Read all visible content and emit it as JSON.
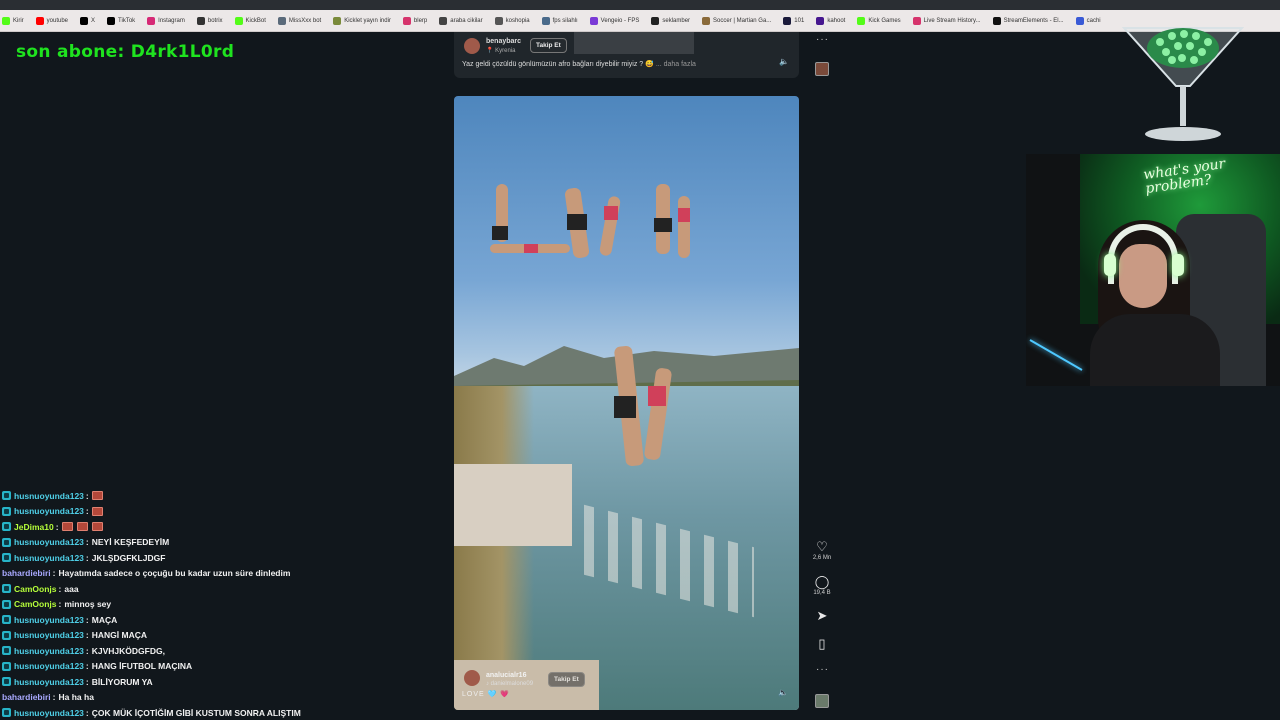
{
  "bookmarks": [
    {
      "label": "Kirir",
      "icon": "kick-icon",
      "color": "#53fc18"
    },
    {
      "label": "youtube",
      "icon": "youtube-icon",
      "color": "#ff0000"
    },
    {
      "label": "X",
      "icon": "x-icon",
      "color": "#000000"
    },
    {
      "label": "TikTok",
      "icon": "tiktok-icon",
      "color": "#000000"
    },
    {
      "label": "Instagram",
      "icon": "instagram-icon",
      "color": "#d62976"
    },
    {
      "label": "botrix",
      "icon": "botrix-icon",
      "color": "#333333"
    },
    {
      "label": "KickBot",
      "icon": "kickbot-icon",
      "color": "#53fc18"
    },
    {
      "label": "MissXxx bot",
      "icon": "bot-icon",
      "color": "#5a6a7a"
    },
    {
      "label": "Kicklet yayın indir",
      "icon": "kicklet-icon",
      "color": "#7a8a3a"
    },
    {
      "label": "blerp",
      "icon": "blerp-icon",
      "color": "#d6336c"
    },
    {
      "label": "araba cikilar",
      "icon": "car-icon",
      "color": "#444444"
    },
    {
      "label": "koshopia",
      "icon": "koshopia-icon",
      "color": "#555555"
    },
    {
      "label": "fps silahlı",
      "icon": "fps-icon",
      "color": "#4a6a8a"
    },
    {
      "label": "Vengeio - FPS",
      "icon": "vengeio-icon",
      "color": "#7a3ad6"
    },
    {
      "label": "seklamber",
      "icon": "seklamber-icon",
      "color": "#222222"
    },
    {
      "label": "Soccer | Martian Ga...",
      "icon": "soccer-icon",
      "color": "#8a6a3a"
    },
    {
      "label": "101",
      "icon": "101-icon",
      "color": "#1a1a3a"
    },
    {
      "label": "kahoot",
      "icon": "kahoot-icon",
      "color": "#46178f"
    },
    {
      "label": "Kick Games",
      "icon": "kick-games-icon",
      "color": "#53fc18"
    },
    {
      "label": "Live Stream History...",
      "icon": "history-icon",
      "color": "#d6336c"
    },
    {
      "label": "StreamElements - El...",
      "icon": "streamelements-icon",
      "color": "#111111"
    },
    {
      "label": "cachi",
      "icon": "cachi-icon",
      "color": "#3a5ad6"
    }
  ],
  "overlay": {
    "last_subscriber": "son abone: D4rk1L0rd"
  },
  "previous_post": {
    "username": "benaybarc",
    "location": "Kyrenia",
    "follow_label": "Takip Et",
    "caption": "Yaz geldi çözüldü gönlümüzün afro bağları diyebilir miyiz ? 😅",
    "more_label": "... daha fazla",
    "volume_icon": "speaker-icon"
  },
  "reel": {
    "username": "analucialr16",
    "audio": "danielmalone09",
    "follow_label": "Takip Et",
    "caption": "LOVE 🩵 💗",
    "volume_icon": "speaker-icon"
  },
  "actions": {
    "like_count": "2,6 Mn",
    "comment_count": "19,4 B",
    "more_label": "···"
  },
  "webcam": {
    "neon_sign": "what's your problem?"
  },
  "chat": [
    {
      "user": "husnuoyunda123",
      "color": "#4fd0e8",
      "text": "",
      "emotes": 1,
      "badge": true
    },
    {
      "user": "husnuoyunda123",
      "color": "#4fd0e8",
      "text": "",
      "emotes": 1,
      "badge": true
    },
    {
      "user": "JeDima10",
      "color": "#b6ff3a",
      "text": "",
      "emotes": 3,
      "badge": true
    },
    {
      "user": "husnuoyunda123",
      "color": "#4fd0e8",
      "text": "NEYİ KEŞFEDEYİM",
      "emotes": 0,
      "badge": true
    },
    {
      "user": "husnuoyunda123",
      "color": "#4fd0e8",
      "text": "JKLŞDGFKLJDGF",
      "emotes": 0,
      "badge": true
    },
    {
      "user": "bahardiebiri",
      "color": "#a9a9ff",
      "text": "Hayatımda sadece o çoçuğu bu kadar uzun süre dinledim",
      "emotes": 0,
      "badge": false
    },
    {
      "user": "CamOonjs",
      "color": "#b6ff3a",
      "text": "aaa",
      "emotes": 0,
      "badge": true
    },
    {
      "user": "CamOonjs",
      "color": "#b6ff3a",
      "text": "minnoş sey",
      "emotes": 0,
      "badge": true
    },
    {
      "user": "husnuoyunda123",
      "color": "#4fd0e8",
      "text": "MAÇA",
      "emotes": 0,
      "badge": true
    },
    {
      "user": "husnuoyunda123",
      "color": "#4fd0e8",
      "text": "HANGİ MAÇA",
      "emotes": 0,
      "badge": true
    },
    {
      "user": "husnuoyunda123",
      "color": "#4fd0e8",
      "text": "KJVHJKÖDGFDG,",
      "emotes": 0,
      "badge": true
    },
    {
      "user": "husnuoyunda123",
      "color": "#4fd0e8",
      "text": "HANG İFUTBOL MAÇINA",
      "emotes": 0,
      "badge": true
    },
    {
      "user": "husnuoyunda123",
      "color": "#4fd0e8",
      "text": "BİLİYORUM YA",
      "emotes": 0,
      "badge": true
    },
    {
      "user": "bahardiebiri",
      "color": "#a9a9ff",
      "text": "Ha ha ha",
      "emotes": 0,
      "badge": false
    },
    {
      "user": "husnuoyunda123",
      "color": "#4fd0e8",
      "text": "ÇOK MÜK İÇOTİĞİM GİBİ KUSTUM SONRA ALIŞTIM",
      "emotes": 0,
      "badge": true
    }
  ],
  "colors": {
    "subscriber_text": "#1fe31f",
    "page_bg": "#11171c",
    "accent_neon": "#8cff9a"
  }
}
